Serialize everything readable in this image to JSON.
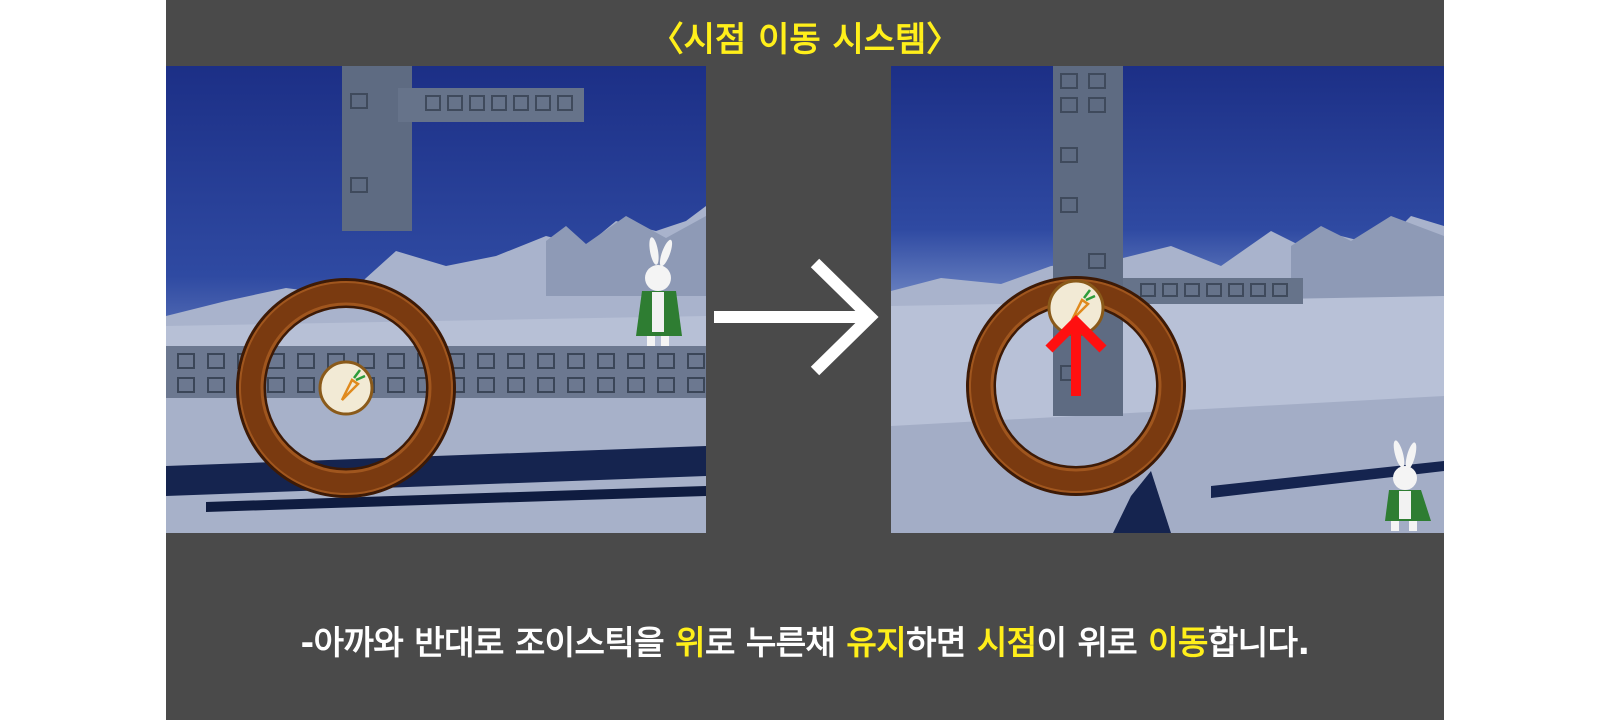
{
  "title": "〈시점 이동 시스템〉",
  "icons": {
    "arrow": "right-arrow-icon",
    "up_arrow": "up-arrow-icon",
    "joystick_knob": "carrot-icon",
    "character": "rabbit-character"
  },
  "colors": {
    "background": "#4a4a4a",
    "title": "#ffef1a",
    "highlight": "#ffef1a",
    "caption": "#ffffff",
    "up_arrow": "#ff1010",
    "joystick_ring": "#7a3a10"
  },
  "caption": {
    "parts": [
      {
        "text": "-아까와 반대로 조이스틱을 ",
        "highlight": false
      },
      {
        "text": "위",
        "highlight": true
      },
      {
        "text": "로 누른채 ",
        "highlight": false
      },
      {
        "text": "유지",
        "highlight": true
      },
      {
        "text": "하면 ",
        "highlight": false
      },
      {
        "text": "시점",
        "highlight": true
      },
      {
        "text": "이 위로 ",
        "highlight": false
      },
      {
        "text": "이동",
        "highlight": true
      },
      {
        "text": "합니다.",
        "highlight": false
      }
    ]
  }
}
